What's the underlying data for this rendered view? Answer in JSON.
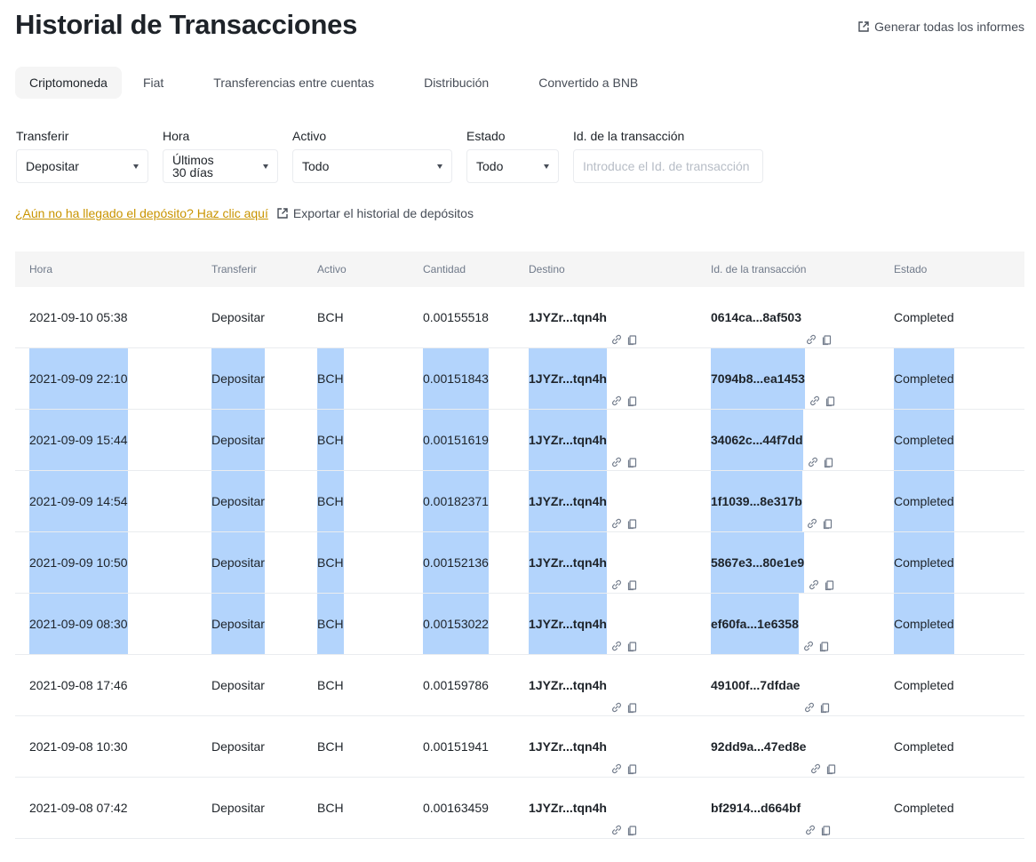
{
  "title": "Historial de Transacciones",
  "generate_reports": "Generar todas los informes",
  "tabs": [
    {
      "label": "Criptomoneda",
      "active": true
    },
    {
      "label": "Fiat"
    },
    {
      "label": "Transferencias entre cuentas"
    },
    {
      "label": "Distribución"
    },
    {
      "label": "Convertido a BNB"
    }
  ],
  "filters": {
    "transfer": {
      "label": "Transferir",
      "value": "Depositar"
    },
    "time": {
      "label": "Hora",
      "value_line1": "Últimos",
      "value_line2": "30 días"
    },
    "asset": {
      "label": "Activo",
      "value": "Todo"
    },
    "status": {
      "label": "Estado",
      "value": "Todo"
    },
    "txid": {
      "label": "Id. de la transacción",
      "placeholder": "Introduce el Id. de transacción"
    }
  },
  "links": {
    "not_arrived": "¿Aún no ha llegado el depósito? Haz clic aquí",
    "export": "Exportar el historial de depósitos"
  },
  "table": {
    "headers": {
      "time": "Hora",
      "type": "Transferir",
      "asset": "Activo",
      "amount": "Cantidad",
      "dest": "Destino",
      "txid": "Id. de la transacción",
      "status": "Estado"
    },
    "rows": [
      {
        "time": "2021-09-10 05:38",
        "type": "Depositar",
        "asset": "BCH",
        "amount": "0.00155518",
        "dest": "1JYZr...tqn4h",
        "txid": "0614ca...8af503",
        "status": "Completed",
        "selected": false
      },
      {
        "time": "2021-09-09 22:10",
        "type": "Depositar",
        "asset": "BCH",
        "amount": "0.00151843",
        "dest": "1JYZr...tqn4h",
        "txid": "7094b8...ea1453",
        "status": "Completed",
        "selected": true
      },
      {
        "time": "2021-09-09 15:44",
        "type": "Depositar",
        "asset": "BCH",
        "amount": "0.00151619",
        "dest": "1JYZr...tqn4h",
        "txid": "34062c...44f7dd",
        "status": "Completed",
        "selected": true
      },
      {
        "time": "2021-09-09 14:54",
        "type": "Depositar",
        "asset": "BCH",
        "amount": "0.00182371",
        "dest": "1JYZr...tqn4h",
        "txid": "1f1039...8e317b",
        "status": "Completed",
        "selected": true
      },
      {
        "time": "2021-09-09 10:50",
        "type": "Depositar",
        "asset": "BCH",
        "amount": "0.00152136",
        "dest": "1JYZr...tqn4h",
        "txid": "5867e3...80e1e9",
        "status": "Completed",
        "selected": true
      },
      {
        "time": "2021-09-09 08:30",
        "type": "Depositar",
        "asset": "BCH",
        "amount": "0.00153022",
        "dest": "1JYZr...tqn4h",
        "txid": "ef60fa...1e6358",
        "status": "Completed",
        "selected": true
      },
      {
        "time": "2021-09-08 17:46",
        "type": "Depositar",
        "asset": "BCH",
        "amount": "0.00159786",
        "dest": "1JYZr...tqn4h",
        "txid": "49100f...7dfdae",
        "status": "Completed",
        "selected": false
      },
      {
        "time": "2021-09-08 10:30",
        "type": "Depositar",
        "asset": "BCH",
        "amount": "0.00151941",
        "dest": "1JYZr...tqn4h",
        "txid": "92dd9a...47ed8e",
        "status": "Completed",
        "selected": false
      },
      {
        "time": "2021-09-08 07:42",
        "type": "Depositar",
        "asset": "BCH",
        "amount": "0.00163459",
        "dest": "1JYZr...tqn4h",
        "txid": "bf2914...d664bf",
        "status": "Completed",
        "selected": false
      }
    ]
  },
  "colors": {
    "link_yellow": "#c99400",
    "selection": "#b3d4fc",
    "header_bg": "#f5f5f5"
  }
}
